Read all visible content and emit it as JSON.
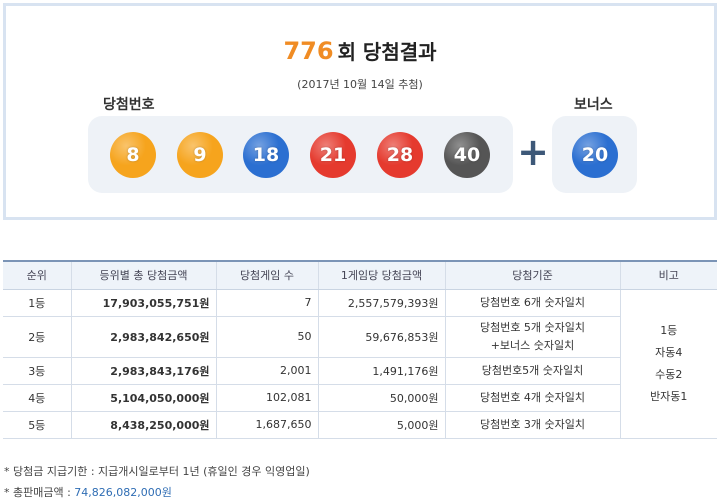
{
  "header": {
    "round_number": "776",
    "round_suffix": "회 당첨결과",
    "draw_date": "(2017년 10월 14일 추첨)",
    "winning_label": "당첨번호",
    "bonus_label": "보너스",
    "plus_symbol": "+"
  },
  "balls": {
    "winning": [
      {
        "number": "8",
        "color": "#f6a41d"
      },
      {
        "number": "9",
        "color": "#f6a41d"
      },
      {
        "number": "18",
        "color": "#2b6fd1"
      },
      {
        "number": "21",
        "color": "#e53a2e"
      },
      {
        "number": "28",
        "color": "#e53a2e"
      },
      {
        "number": "40",
        "color": "#555555"
      }
    ],
    "bonus": {
      "number": "20",
      "color": "#2b6fd1"
    }
  },
  "table": {
    "headers": [
      "순위",
      "등위별 총 당첨금액",
      "당첨게임 수",
      "1게임당 당첨금액",
      "당첨기준",
      "비고"
    ],
    "rows": [
      {
        "rank": "1등",
        "total": "17,903,055,751원",
        "count": "7",
        "per_game": "2,557,579,393원",
        "criteria_lines": [
          "당첨번호 6개 숫자일치"
        ]
      },
      {
        "rank": "2등",
        "total": "2,983,842,650원",
        "count": "50",
        "per_game": "59,676,853원",
        "criteria_lines": [
          "당첨번호 5개 숫자일치",
          "+보너스 숫자일치"
        ]
      },
      {
        "rank": "3등",
        "total": "2,983,843,176원",
        "count": "2,001",
        "per_game": "1,491,176원",
        "criteria_lines": [
          "당첨번호5개 숫자일치"
        ]
      },
      {
        "rank": "4등",
        "total": "5,104,050,000원",
        "count": "102,081",
        "per_game": "50,000원",
        "criteria_lines": [
          "당첨번호 4개 숫자일치"
        ]
      },
      {
        "rank": "5등",
        "total": "8,438,250,000원",
        "count": "1,687,650",
        "per_game": "5,000원",
        "criteria_lines": [
          "당첨번호 3개 숫자일치"
        ]
      }
    ],
    "note_lines": [
      "1등",
      "자동4",
      "수동2",
      "반자동1"
    ]
  },
  "footnotes": {
    "deadline": "* 당첨금 지급기한 : 지급개시일로부터 1년 (휴일인 경우 익영업일)",
    "sales_label": "* 총판매금액 : ",
    "sales_value": "74,826,082,000원"
  }
}
